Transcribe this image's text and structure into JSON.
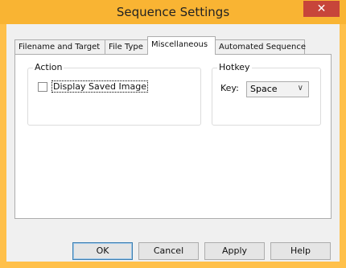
{
  "window": {
    "title": "Sequence Settings",
    "close_glyph": "✕",
    "accent_color": "#f9b433",
    "close_color": "#c7453a"
  },
  "tabs": [
    {
      "label": "Filename and Target",
      "active": false
    },
    {
      "label": "File Type",
      "active": false
    },
    {
      "label": "Miscellaneous",
      "active": true
    },
    {
      "label": "Automated Sequence",
      "active": false
    }
  ],
  "action_group": {
    "label": "Action",
    "checkbox": {
      "label": "Display Saved Image",
      "checked": false
    }
  },
  "hotkey_group": {
    "label": "Hotkey",
    "key_label": "Key:",
    "key_value": "Space",
    "dropdown_icon": "chevron-down-icon"
  },
  "buttons": {
    "ok": "OK",
    "cancel": "Cancel",
    "apply": "Apply",
    "help": "Help"
  }
}
